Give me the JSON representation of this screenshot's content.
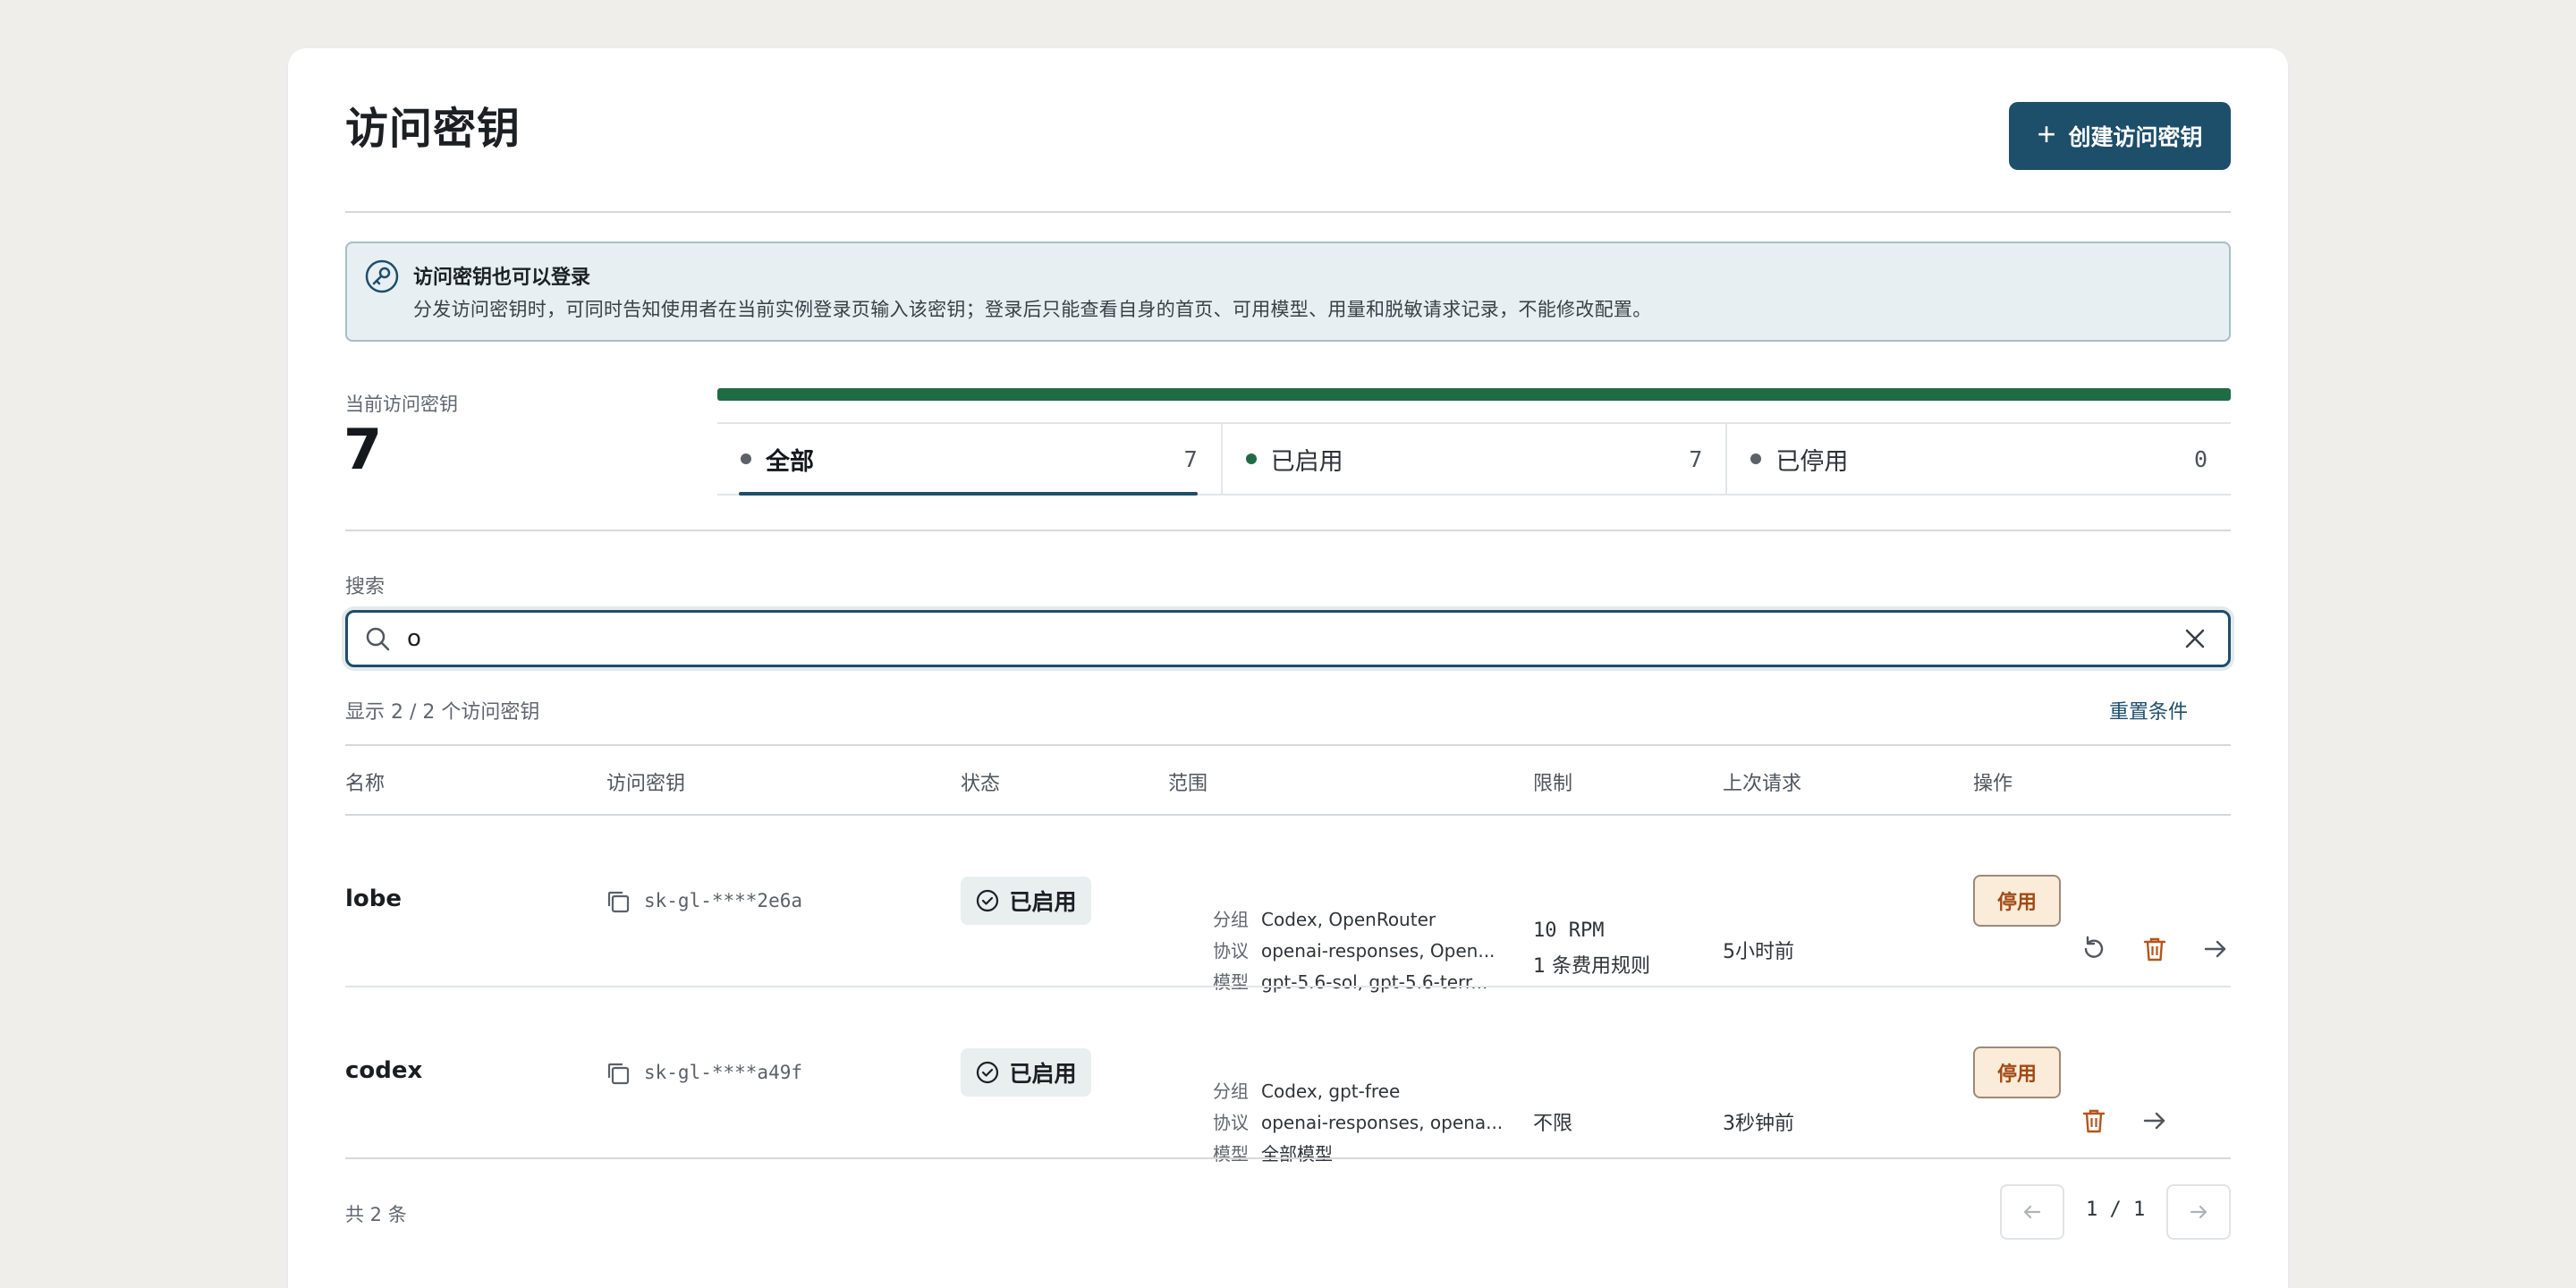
{
  "header": {
    "title": "访问密钥",
    "create_label": "创建访问密钥"
  },
  "notice": {
    "title": "访问密钥也可以登录",
    "description": "分发访问密钥时，可同时告知使用者在当前实例登录页输入该密钥；登录后只能查看自身的首页、可用模型、用量和脱敏请求记录，不能修改配置。"
  },
  "summary": {
    "label": "当前访问密钥",
    "count": "7",
    "enabled_fraction": 1.0,
    "tabs": [
      {
        "label": "全部",
        "count": "7",
        "color": "#5c6168"
      },
      {
        "label": "已启用",
        "count": "7",
        "color": "#1f6b44"
      },
      {
        "label": "已停用",
        "count": "0",
        "color": "#5c6168"
      }
    ]
  },
  "search": {
    "label": "搜索",
    "value": "o"
  },
  "results": {
    "info": "显示 2 / 2 个访问密钥",
    "reset_label": "重置条件"
  },
  "table": {
    "columns": [
      "名称",
      "访问密钥",
      "状态",
      "范围",
      "限制",
      "上次请求",
      "操作"
    ],
    "scope_keys": [
      "分组",
      "协议",
      "模型"
    ],
    "rows": [
      {
        "name": "lobe",
        "key": "sk-gl-****2e6a",
        "status": "已启用",
        "scope": [
          "Codex, OpenRouter",
          "openai-responses, Open...",
          "gpt-5.6-sol, gpt-5.6-terr..."
        ],
        "limit": [
          "10 RPM",
          "1 条费用规则"
        ],
        "last_request": "5小时前",
        "action_label": "停用"
      },
      {
        "name": "codex",
        "key": "sk-gl-****a49f",
        "status": "已启用",
        "scope": [
          "Codex, gpt-free",
          "openai-responses, opena...",
          "全部模型"
        ],
        "limit": [
          "不限"
        ],
        "last_request": "3秒钟前",
        "action_label": "停用"
      }
    ]
  },
  "footer": {
    "total": "共 2 条",
    "page": "1 / 1"
  },
  "colors": {
    "accent": "#1d4e6a",
    "enabled": "#1f6b44",
    "danger": "#b5541c"
  }
}
